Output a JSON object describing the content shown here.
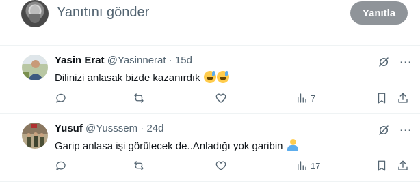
{
  "composer": {
    "placeholder": "Yanıtını gönder",
    "reply_button_label": "Yanıtla"
  },
  "replies": [
    {
      "display_name": "Yasin Erat",
      "handle": "@Yasinnerat",
      "separator": "·",
      "time": "15d",
      "text": "Dilinizi anlasak bizde kazanırdık",
      "emojis": [
        "grinning-sweat-emoji",
        "grinning-sweat-emoji"
      ],
      "views": "7",
      "more_label": "···"
    },
    {
      "display_name": "Yusuf",
      "handle": "@Yusssem",
      "separator": "·",
      "time": "24d",
      "text": "Garip anlasa işi görülecek de..Anladığı yok garibin",
      "emojis": [
        "person-shrugging-emoji"
      ],
      "views": "17",
      "more_label": "···"
    }
  ],
  "colors": {
    "text_primary": "#0f1419",
    "text_secondary": "#536471",
    "button_disabled": "#8f9499",
    "divider": "#eff3f4"
  }
}
